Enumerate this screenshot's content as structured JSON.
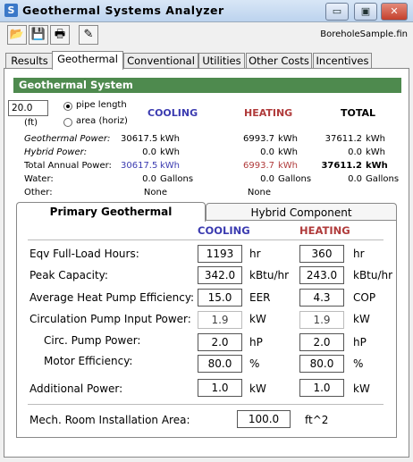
{
  "window": {
    "title": "Geothermal Systems Analyzer",
    "icon_letter": "S"
  },
  "window_buttons": {
    "minimize": "▭",
    "maximize": "▣",
    "close": "✕"
  },
  "toolbar": {
    "filename": "BoreholeSample.fin"
  },
  "tabs": [
    "Results",
    "Geothermal",
    "Conventional",
    "Utilities",
    "Other Costs",
    "Incentives"
  ],
  "section_title": "Geothermal System",
  "pipe": {
    "value": "20.0",
    "unit": "(ft)",
    "options": [
      "pipe length",
      "area (horiz)"
    ],
    "selected": "pipe length"
  },
  "summary": {
    "headers": {
      "cooling": "COOLING",
      "heating": "HEATING",
      "total": "TOTAL"
    },
    "rows": [
      {
        "label": "Geothermal Power:",
        "cooling": "30617.5",
        "cooling_unit": "kWh",
        "heating": "6993.7",
        "heating_unit": "kWh",
        "total": "37611.2",
        "total_unit": "kWh"
      },
      {
        "label": "Hybrid Power:",
        "cooling": "0.0",
        "cooling_unit": "kWh",
        "heating": "0.0",
        "heating_unit": "kWh",
        "total": "0.0",
        "total_unit": "kWh"
      },
      {
        "label": "Total Annual Power:",
        "cooling": "30617.5",
        "cooling_unit": "kWh",
        "heating": "6993.7",
        "heating_unit": "kWh",
        "total": "37611.2",
        "total_unit": "kWh"
      },
      {
        "label": "Water:",
        "cooling": "0.0",
        "cooling_unit": "Gallons",
        "heating": "0.0",
        "heating_unit": "Gallons",
        "total": "0.0",
        "total_unit": "Gallons"
      },
      {
        "label": "Other:",
        "cooling": "None",
        "cooling_unit": "",
        "heating": "None",
        "heating_unit": "",
        "total": "",
        "total_unit": ""
      }
    ]
  },
  "lower_tabs": [
    "Primary Geothermal",
    "Hybrid Component"
  ],
  "primary": {
    "headers": {
      "cooling": "COOLING",
      "heating": "HEATING"
    },
    "rows": [
      {
        "label": "Eqv Full-Load Hours:",
        "cooling": "1193",
        "cooling_unit": "hr",
        "heating": "360",
        "heating_unit": "hr"
      },
      {
        "label": "Peak Capacity:",
        "cooling": "342.0",
        "cooling_unit": "kBtu/hr",
        "heating": "243.0",
        "heating_unit": "kBtu/hr"
      },
      {
        "label": "Average Heat Pump Efficiency:",
        "cooling": "15.0",
        "cooling_unit": "EER",
        "heating": "4.3",
        "heating_unit": "COP"
      },
      {
        "label": "Circulation Pump Input Power:",
        "cooling": "1.9",
        "cooling_unit": "kW",
        "heating": "1.9",
        "heating_unit": "kW"
      },
      {
        "label": "Circ. Pump Power:",
        "cooling": "2.0",
        "cooling_unit": "hP",
        "heating": "2.0",
        "heating_unit": "hP"
      },
      {
        "label": "Motor Efficiency:",
        "cooling": "80.0",
        "cooling_unit": "%",
        "heating": "80.0",
        "heating_unit": "%"
      },
      {
        "label": "Additional Power:",
        "cooling": "1.0",
        "cooling_unit": "kW",
        "heating": "1.0",
        "heating_unit": "kW"
      }
    ],
    "mech_room": {
      "label": "Mech. Room Installation Area:",
      "value": "100.0",
      "unit": "ft^2"
    }
  }
}
